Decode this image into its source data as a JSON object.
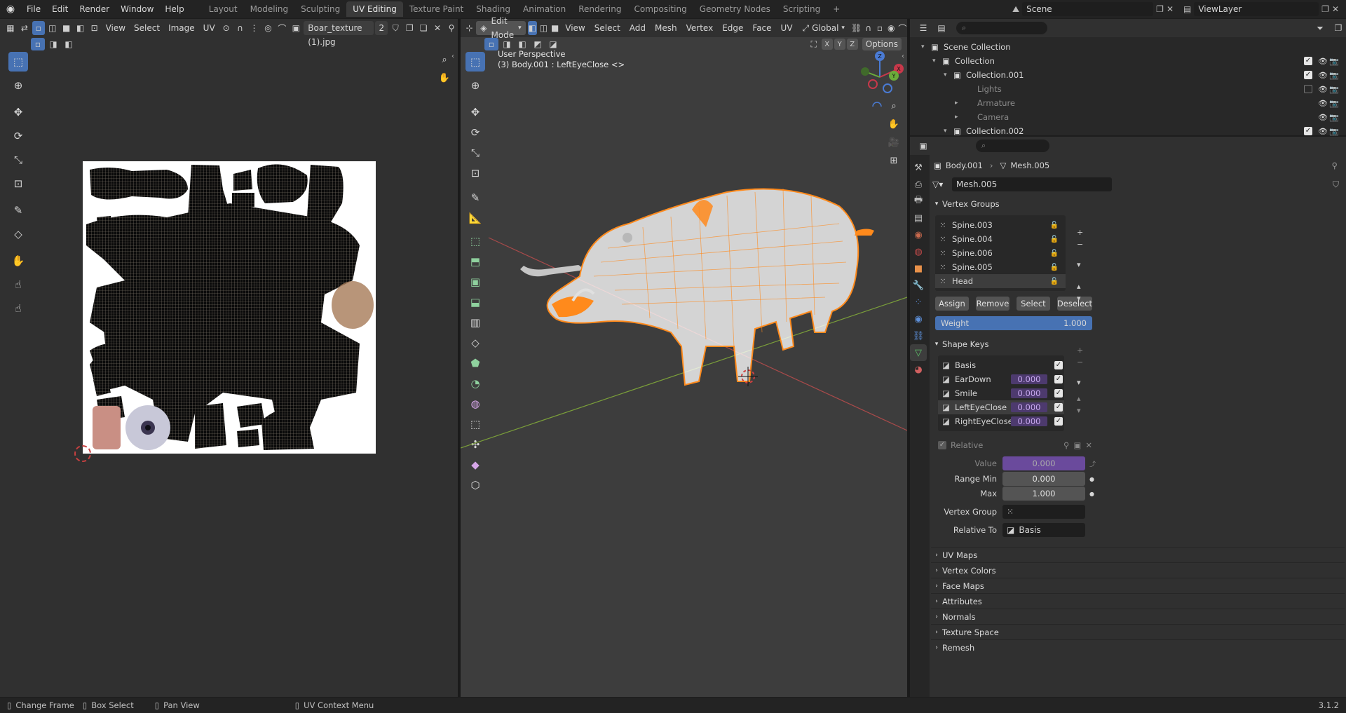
{
  "topbar": {
    "menus": [
      "File",
      "Edit",
      "Render",
      "Window",
      "Help"
    ],
    "workspaces": [
      "Layout",
      "Modeling",
      "Sculpting",
      "UV Editing",
      "Texture Paint",
      "Shading",
      "Animation",
      "Rendering",
      "Compositing",
      "Geometry Nodes",
      "Scripting"
    ],
    "active_workspace": "UV Editing",
    "add_tab": "+",
    "scene": "Scene",
    "view_layer": "ViewLayer"
  },
  "uv_editor": {
    "menus": [
      "View",
      "Select",
      "Image",
      "UV"
    ],
    "image_name": "Boar_texture (1).jpg",
    "image_users": "2"
  },
  "viewport": {
    "mode": "Edit Mode",
    "menus": [
      "View",
      "Select",
      "Add",
      "Mesh",
      "Vertex",
      "Edge",
      "Face",
      "UV"
    ],
    "orientation": "Global",
    "axes": [
      "X",
      "Y",
      "Z"
    ],
    "options": "Options",
    "perspective": "User Perspective",
    "object_info": "(3) Body.001 : LeftEyeClose <>",
    "gizmo": {
      "x": "X",
      "y": "Y",
      "z": "Z"
    }
  },
  "outliner": {
    "rows": [
      {
        "label": "Scene Collection",
        "indent": 0,
        "check": false
      },
      {
        "label": "Collection",
        "indent": 1,
        "check": true
      },
      {
        "label": "Collection.001",
        "indent": 2,
        "check": true
      },
      {
        "label": "Lights",
        "indent": 3,
        "check": false
      },
      {
        "label": "Armature",
        "indent": 3,
        "check": false
      },
      {
        "label": "Camera",
        "indent": 3,
        "check": false
      },
      {
        "label": "Collection.002",
        "indent": 2,
        "check": true
      }
    ]
  },
  "properties": {
    "breadcrumb_object": "Body.001",
    "breadcrumb_mesh": "Mesh.005",
    "mesh_name": "Mesh.005",
    "vertex_groups": {
      "title": "Vertex Groups",
      "items": [
        "Spine.003",
        "Spine.004",
        "Spine.006",
        "Spine.005",
        "Head"
      ],
      "selected": "Head",
      "buttons": [
        "Assign",
        "Remove",
        "Select",
        "Deselect"
      ],
      "weight_label": "Weight",
      "weight_value": "1.000"
    },
    "shape_keys": {
      "title": "Shape Keys",
      "items": [
        {
          "name": "Basis",
          "value": ""
        },
        {
          "name": "EarDown",
          "value": "0.000"
        },
        {
          "name": "Smile",
          "value": "0.000"
        },
        {
          "name": "LeftEyeClose",
          "value": "0.000"
        },
        {
          "name": "RightEyeClose",
          "value": "0.000"
        }
      ],
      "selected": "LeftEyeClose",
      "relative_label": "Relative",
      "value_label": "Value",
      "value": "0.000",
      "range_min_label": "Range Min",
      "range_min": "0.000",
      "max_label": "Max",
      "max": "1.000",
      "vertex_group_label": "Vertex Group",
      "relative_to_label": "Relative To",
      "relative_to": "Basis"
    },
    "collapsed_panels": [
      "UV Maps",
      "Vertex Colors",
      "Face Maps",
      "Attributes",
      "Normals",
      "Texture Space",
      "Remesh"
    ]
  },
  "statusbar": {
    "items": [
      "Change Frame",
      "Box Select",
      "Pan View",
      "UV Context Menu"
    ],
    "version": "3.1.2"
  },
  "colors": {
    "accent": "#4772b3",
    "mesh_orange": "#ff8a1c",
    "shape_value": "#6a4a9c"
  }
}
